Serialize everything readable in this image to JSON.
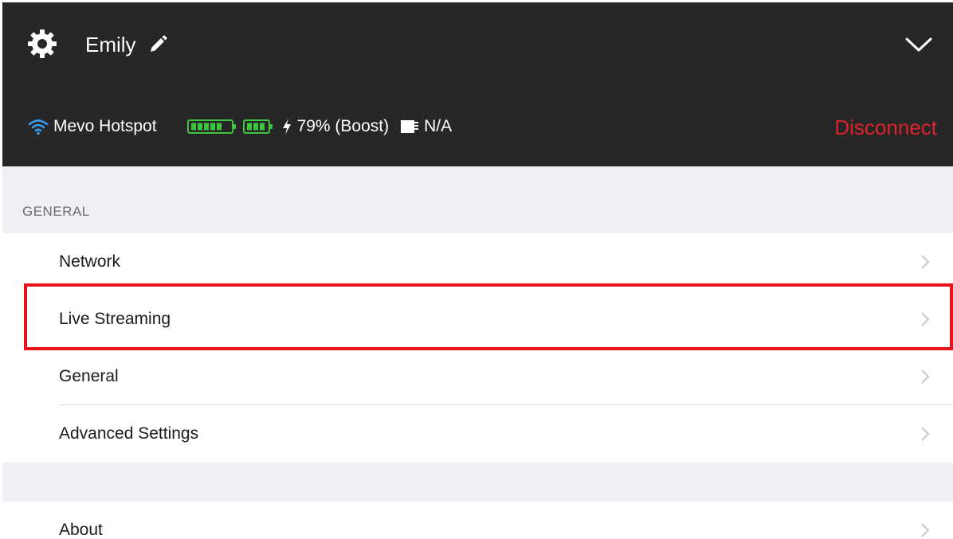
{
  "header": {
    "title": "Emily",
    "collapse_icon": "chevron-down-icon"
  },
  "status": {
    "network_name": "Mevo Hotspot",
    "battery_text": "79% (Boost)",
    "storage_text": "N/A",
    "disconnect_label": "Disconnect",
    "colors": {
      "wifi": "#3b9ff6",
      "battery": "#3ec63e",
      "disconnect": "#e0222f"
    }
  },
  "sections": {
    "general_header": "GENERAL",
    "general_items": [
      {
        "label": "Network"
      },
      {
        "label": "Live Streaming"
      },
      {
        "label": "General"
      },
      {
        "label": "Advanced Settings"
      }
    ],
    "about_item": {
      "label": "About"
    }
  },
  "annotation": {
    "highlight_color": "#e8141c"
  }
}
